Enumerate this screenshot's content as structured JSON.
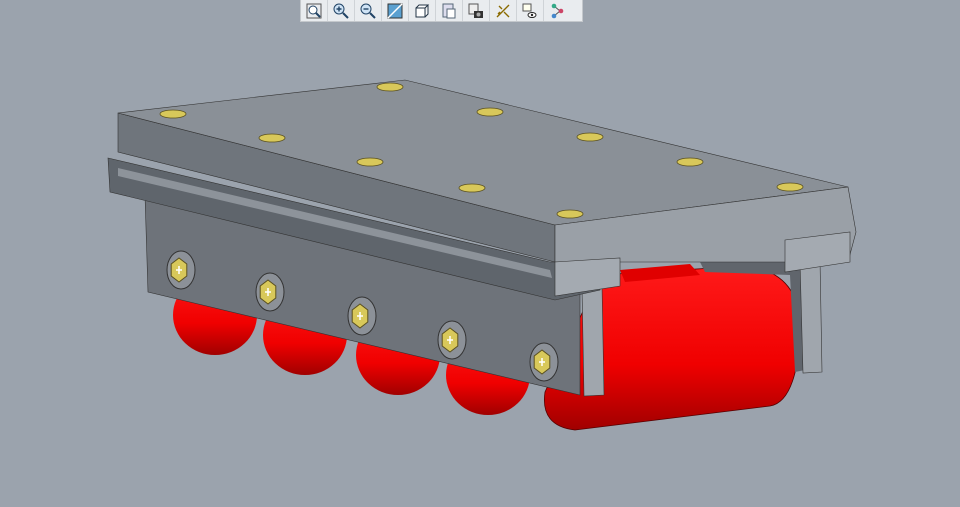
{
  "toolbar": {
    "buttons": [
      {
        "icon": "refit-zoom-icon"
      },
      {
        "icon": "zoom-in-icon"
      },
      {
        "icon": "zoom-out-icon"
      },
      {
        "icon": "repaint-icon"
      },
      {
        "icon": "saved-orientations-icon"
      },
      {
        "icon": "view-manager-icon"
      },
      {
        "icon": "screenshot-camera-icon"
      },
      {
        "icon": "datum-display-icon"
      },
      {
        "icon": "hide-show-icon"
      },
      {
        "icon": "model-tree-icon"
      }
    ]
  },
  "viewport": {
    "background": "#9ba3ad",
    "model": {
      "plate_color": "#8a9097",
      "frame_color": "#6c7279",
      "roller_color": "#ff0000",
      "bolt_color": "#d8c85a"
    }
  }
}
